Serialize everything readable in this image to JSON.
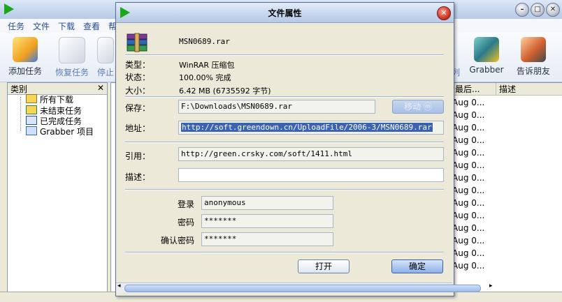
{
  "main_window": {
    "menu": [
      "任务",
      "文件",
      "下载",
      "查看",
      "帮"
    ],
    "toolbar": {
      "add_task": "添加任务",
      "resume_task": "恢复任务",
      "stop": "停止",
      "grabber": "Grabber",
      "tell_friend": "告诉朋友"
    },
    "sidebar": {
      "header": "类别",
      "close": "✕",
      "items": [
        "所有下载",
        "未结束任务",
        "已完成任务",
        "Grabber 项目"
      ]
    },
    "list": {
      "columns": [
        "最后...",
        "描述"
      ],
      "rows": [
        "Aug 0...",
        "Aug 0...",
        "Aug 0...",
        "Aug 0...",
        "Aug 0...",
        "Aug 0...",
        "Aug 0...",
        "Aug 0...",
        "Aug 0...",
        "Aug 0...",
        "Aug 0...",
        "Aug 0...",
        "Aug 0...",
        "Aug 0..."
      ]
    },
    "partial_labels": {
      "col_right": "列"
    }
  },
  "dialog": {
    "title": "文件属性",
    "file_name": "MSN0689.rar",
    "type_label": "类型：",
    "type_value": "WinRAR 压缩包",
    "status_label": "状态：",
    "status_value": "100.00% 完成",
    "size_label": "大小：",
    "size_value": "6.42  MB (6735592 字节)",
    "save_label": "保存：",
    "save_value": "F:\\Downloads\\MSN0689.rar",
    "move_button": "移动 ⓜ",
    "address_label": "地址：",
    "address_value": "http://soft.greendown.cn/UploadFile/2006-3/MSN0689.rar",
    "referrer_label": "引用：",
    "referrer_value": "http://green.crsky.com/soft/1411.html",
    "description_label": "描述：",
    "description_value": "",
    "login_label": "登录",
    "login_value": "anonymous",
    "password_label": "密码",
    "password_value": "*******",
    "confirm_label": "确认密码",
    "confirm_value": "*******",
    "open_button": "打开",
    "ok_button": "确定"
  },
  "colors": {
    "accent": "#3b63b3",
    "title_gradient": "#c8d7ee",
    "close_red": "#d23a2a",
    "play_green": "#1aa81a"
  }
}
